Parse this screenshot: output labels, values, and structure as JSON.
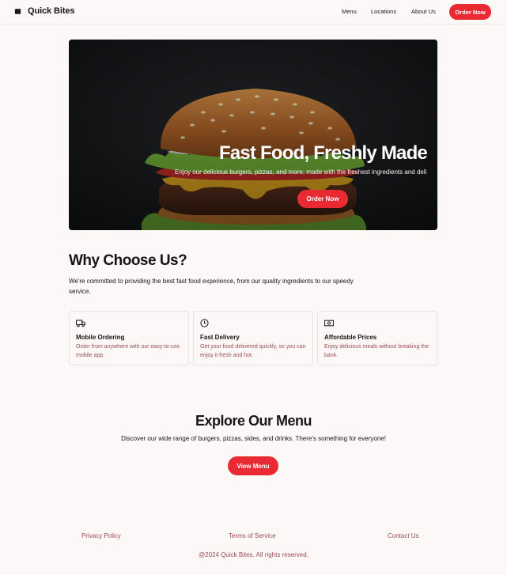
{
  "header": {
    "brand": "Quick Bites",
    "nav": [
      "Menu",
      "Locations",
      "About Us"
    ],
    "cta": "Order Now"
  },
  "hero": {
    "title": "Fast Food, Freshly Made",
    "subtitle": "Enjoy our delicious burgers, pizzas, and more, made with the freshest ingredients and deli",
    "cta": "Order Now",
    "image": "burger-photo"
  },
  "why": {
    "title": "Why Choose Us?",
    "text": "We're committed to providing the best fast food experience, from our quality ingredients to our speedy service.",
    "cards": [
      {
        "icon": "truck-icon",
        "title": "Mobile Ordering",
        "desc": "Order from anywhere with our easy-to-use mobile app."
      },
      {
        "icon": "clock-icon",
        "title": "Fast Delivery",
        "desc": "Get your food delivered quickly, so you can enjoy it fresh and hot."
      },
      {
        "icon": "money-icon",
        "title": "Affordable Prices",
        "desc": "Enjoy delicious meals without breaking the bank."
      }
    ]
  },
  "menu_section": {
    "title": "Explore Our Menu",
    "subtitle": "Discover our wide range of burgers, pizzas, sides, and drinks. There's something for everyone!",
    "cta": "View Menu"
  },
  "footer": {
    "links": [
      "Privacy Policy",
      "Terms of Service",
      "Contact Us"
    ],
    "copyright": "@2024 Quick Bites. All rights reserved."
  },
  "colors": {
    "accent": "#ea2a33",
    "background": "#fbf8f7",
    "text": "#1c1414",
    "muted": "#9c4d53"
  }
}
